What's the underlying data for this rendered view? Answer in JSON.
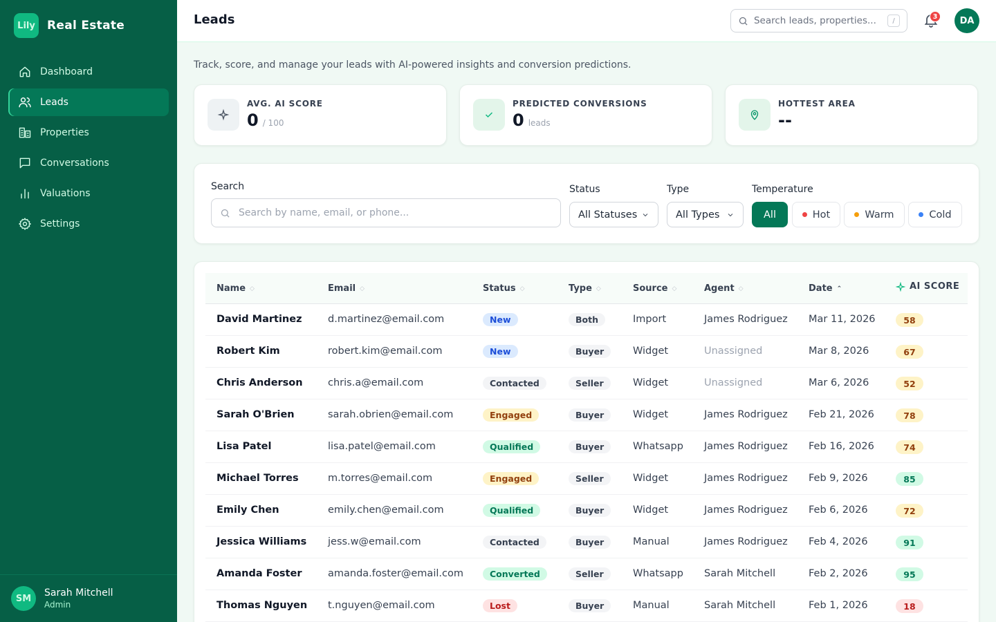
{
  "sidebar": {
    "logo_text": "Lily",
    "brand": "Real Estate",
    "items": [
      {
        "label": "Dashboard",
        "icon": "home-icon",
        "active": false
      },
      {
        "label": "Leads",
        "icon": "users-icon",
        "active": true
      },
      {
        "label": "Properties",
        "icon": "building-icon",
        "active": false
      },
      {
        "label": "Conversations",
        "icon": "chat-icon",
        "active": false
      },
      {
        "label": "Valuations",
        "icon": "bar-chart-icon",
        "active": false
      },
      {
        "label": "Settings",
        "icon": "gear-icon",
        "active": false
      }
    ],
    "user": {
      "initials": "SM",
      "name": "Sarah Mitchell",
      "role": "Admin"
    }
  },
  "header": {
    "title": "Leads",
    "search_placeholder": "Search leads, properties...",
    "search_shortcut": "/",
    "notification_count": "3",
    "avatar_initials": "DA"
  },
  "subtitle": "Track, score, and manage your leads with AI-powered insights and conversion predictions.",
  "stats": [
    {
      "label": "AVG. AI SCORE",
      "value": "0",
      "unit": "/ 100",
      "icon": "sparkle-icon"
    },
    {
      "label": "PREDICTED CONVERSIONS",
      "value": "0",
      "unit": "leads",
      "icon": "check-icon"
    },
    {
      "label": "HOTTEST AREA",
      "value": "--",
      "unit": "",
      "icon": "map-pin-icon"
    }
  ],
  "filters": {
    "search_label": "Search",
    "search_placeholder": "Search by name, email, or phone...",
    "status_label": "Status",
    "status_value": "All Statuses",
    "type_label": "Type",
    "type_value": "All Types",
    "temperature_label": "Temperature",
    "temperatures": [
      {
        "label": "All",
        "active": true,
        "dot": ""
      },
      {
        "label": "Hot",
        "active": false,
        "dot": "#ef4444"
      },
      {
        "label": "Warm",
        "active": false,
        "dot": "#f59e0b"
      },
      {
        "label": "Cold",
        "active": false,
        "dot": "#3b82f6"
      }
    ]
  },
  "table": {
    "columns": [
      "Name",
      "Email",
      "Status",
      "Type",
      "Source",
      "Agent",
      "Date",
      "AI SCORE"
    ],
    "sorted_column": "Date",
    "rows": [
      {
        "name": "David Martinez",
        "email": "d.martinez@email.com",
        "status": "New",
        "type": "Both",
        "source": "Import",
        "agent": "James Rodriguez",
        "date": "Mar 11, 2026",
        "score": "58"
      },
      {
        "name": "Robert Kim",
        "email": "robert.kim@email.com",
        "status": "New",
        "type": "Buyer",
        "source": "Widget",
        "agent": "Unassigned",
        "date": "Mar 8, 2026",
        "score": "67"
      },
      {
        "name": "Chris Anderson",
        "email": "chris.a@email.com",
        "status": "Contacted",
        "type": "Seller",
        "source": "Widget",
        "agent": "Unassigned",
        "date": "Mar 6, 2026",
        "score": "52"
      },
      {
        "name": "Sarah O'Brien",
        "email": "sarah.obrien@email.com",
        "status": "Engaged",
        "type": "Buyer",
        "source": "Widget",
        "agent": "James Rodriguez",
        "date": "Feb 21, 2026",
        "score": "78"
      },
      {
        "name": "Lisa Patel",
        "email": "lisa.patel@email.com",
        "status": "Qualified",
        "type": "Buyer",
        "source": "Whatsapp",
        "agent": "James Rodriguez",
        "date": "Feb 16, 2026",
        "score": "74"
      },
      {
        "name": "Michael Torres",
        "email": "m.torres@email.com",
        "status": "Engaged",
        "type": "Seller",
        "source": "Widget",
        "agent": "James Rodriguez",
        "date": "Feb 9, 2026",
        "score": "85"
      },
      {
        "name": "Emily Chen",
        "email": "emily.chen@email.com",
        "status": "Qualified",
        "type": "Buyer",
        "source": "Widget",
        "agent": "James Rodriguez",
        "date": "Feb 6, 2026",
        "score": "72"
      },
      {
        "name": "Jessica Williams",
        "email": "jess.w@email.com",
        "status": "Contacted",
        "type": "Buyer",
        "source": "Manual",
        "agent": "James Rodriguez",
        "date": "Feb 4, 2026",
        "score": "91"
      },
      {
        "name": "Amanda Foster",
        "email": "amanda.foster@email.com",
        "status": "Converted",
        "type": "Seller",
        "source": "Whatsapp",
        "agent": "Sarah Mitchell",
        "date": "Feb 2, 2026",
        "score": "95"
      },
      {
        "name": "Thomas Nguyen",
        "email": "t.nguyen@email.com",
        "status": "Lost",
        "type": "Buyer",
        "source": "Manual",
        "agent": "Sarah Mitchell",
        "date": "Feb 1, 2026",
        "score": "18"
      }
    ]
  },
  "colors": {
    "sidebar_bg": "#065f46",
    "accent": "#047857",
    "status_new": "#dbeafe",
    "status_engaged": "#fef3c7",
    "status_qualified": "#d1fae5",
    "status_lost": "#fee2e2",
    "score_high": "#d1fae5",
    "score_mid": "#fef3c7",
    "score_low": "#fee2e2"
  }
}
